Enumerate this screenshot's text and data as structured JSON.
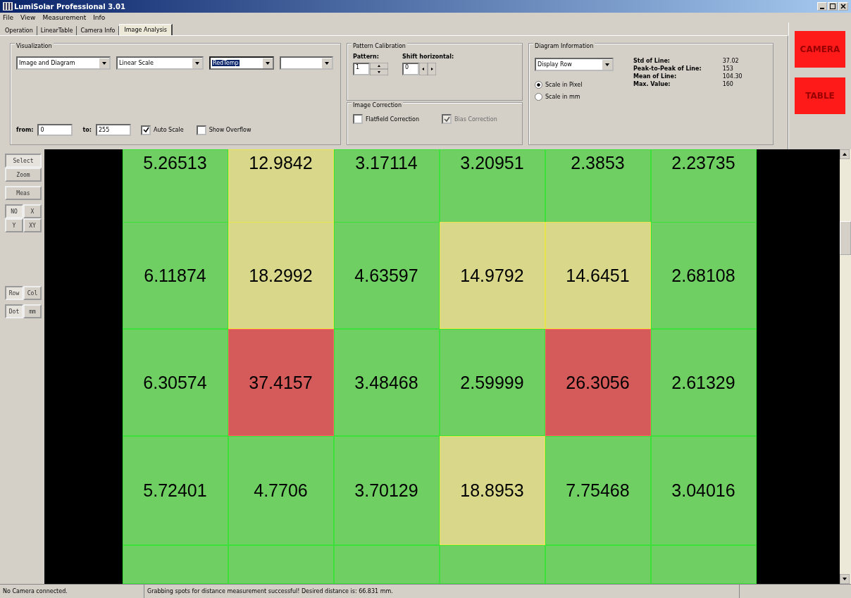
{
  "window": {
    "title": "LumiSolar Professional 3.01"
  },
  "menu": [
    "File",
    "View",
    "Measurement",
    "Info"
  ],
  "tabs": [
    {
      "label": "Operation",
      "selected": false
    },
    {
      "label": "LinearTable",
      "selected": false
    },
    {
      "label": "Camera Info",
      "selected": false
    },
    {
      "label": "Image Analysis",
      "selected": true
    }
  ],
  "visualization": {
    "title": "Visualization",
    "dropdowns": [
      {
        "value": "Image and Diagram",
        "highlighted": false
      },
      {
        "value": "Linear Scale",
        "highlighted": false
      },
      {
        "value": "RedTemp",
        "highlighted": true
      },
      {
        "highlighted": false
      }
    ],
    "from_label": "from:",
    "from_value": "0",
    "to_label": "to:",
    "to_value": "255",
    "checkboxes": [
      {
        "label": "Auto Scale",
        "checked": true,
        "disabled": false
      },
      {
        "label": "Show Overflow",
        "checked": false,
        "disabled": false
      }
    ]
  },
  "pattern_calibration": {
    "title": "Pattern Calibration",
    "pattern_label": "Pattern:",
    "pattern_value": "1",
    "shift_label": "Shift horizontal:",
    "shift_value": "0"
  },
  "image_correction": {
    "title": "Image Correction",
    "checkboxes": [
      {
        "label": "Flatfield Correction",
        "checked": false,
        "disabled": false
      },
      {
        "label": "Bias Correction",
        "checked": true,
        "disabled": true
      }
    ]
  },
  "diagram_information": {
    "title": "Diagram Information",
    "dropdown": "Display Row",
    "radios": [
      {
        "label": "Scale in Pixel",
        "selected": true
      },
      {
        "label": "Scale in mm",
        "selected": false
      }
    ],
    "stats": [
      {
        "label": "Std of Line:",
        "value": "37.02"
      },
      {
        "label": "Peak-to-Peak of Line:",
        "value": "153"
      },
      {
        "label": "Mean of Line:",
        "value": "104.30"
      },
      {
        "label": "Max. Value:",
        "value": "160"
      }
    ]
  },
  "action_buttons": [
    "CAMERA",
    "TABLE"
  ],
  "tool_groups": [
    [
      {
        "label": "Select",
        "selected": true
      },
      {
        "label": "Zoom",
        "selected": false
      }
    ],
    [
      {
        "label": "Meas",
        "selected": false
      }
    ],
    [
      {
        "label": "NO",
        "selected": true
      },
      {
        "label": "X",
        "selected": false
      },
      {
        "label": "Y",
        "selected": false
      },
      {
        "label": "XY",
        "selected": false
      }
    ],
    [
      {
        "label": "Row",
        "selected": true
      },
      {
        "label": "Col",
        "selected": false
      }
    ],
    [
      {
        "label": "Dot",
        "selected": true
      },
      {
        "label": "mm",
        "selected": false
      }
    ]
  ],
  "cell_grid": {
    "rows": [
      [
        {
          "value": "5.26513",
          "kind": "ok"
        },
        {
          "value": "12.9842",
          "kind": "warn"
        },
        {
          "value": "3.17114",
          "kind": "ok"
        },
        {
          "value": "3.20951",
          "kind": "ok"
        },
        {
          "value": "2.3853",
          "kind": "ok"
        },
        {
          "value": "2.23735",
          "kind": "ok"
        }
      ],
      [
        {
          "value": "6.11874",
          "kind": "ok"
        },
        {
          "value": "18.2992",
          "kind": "warn"
        },
        {
          "value": "4.63597",
          "kind": "ok"
        },
        {
          "value": "14.9792",
          "kind": "warn"
        },
        {
          "value": "14.6451",
          "kind": "warn"
        },
        {
          "value": "2.68108",
          "kind": "ok"
        }
      ],
      [
        {
          "value": "6.30574",
          "kind": "ok"
        },
        {
          "value": "37.4157",
          "kind": "defect"
        },
        {
          "value": "3.48468",
          "kind": "ok"
        },
        {
          "value": "2.59999",
          "kind": "ok"
        },
        {
          "value": "26.3056",
          "kind": "defect"
        },
        {
          "value": "2.61329",
          "kind": "ok"
        }
      ],
      [
        {
          "value": "5.72401",
          "kind": "ok"
        },
        {
          "value": "4.7706",
          "kind": "ok"
        },
        {
          "value": "3.70129",
          "kind": "ok"
        },
        {
          "value": "18.8953",
          "kind": "warn"
        },
        {
          "value": "7.75468",
          "kind": "ok"
        },
        {
          "value": "3.04016",
          "kind": "ok"
        }
      ]
    ]
  },
  "status_bar": [
    "No Camera connected.",
    "Grabbing spots for distance measurement successful! Desired distance is:  66.831 mm."
  ]
}
